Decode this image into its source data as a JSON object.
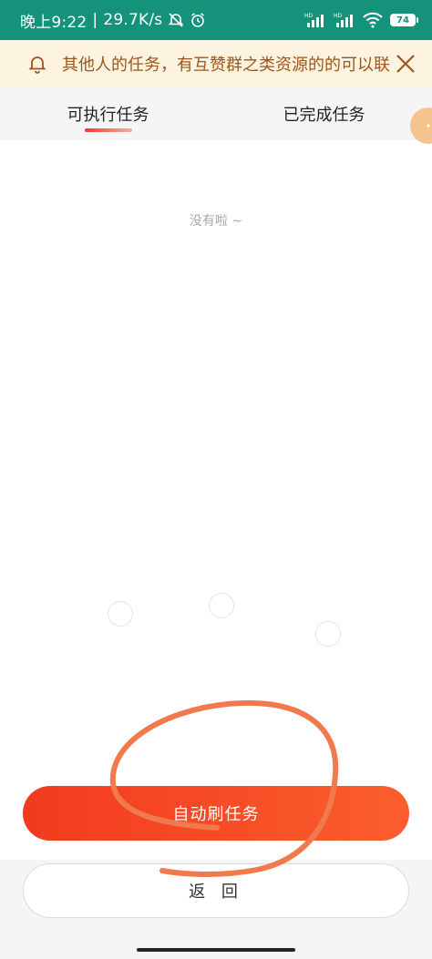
{
  "status_bar": {
    "time": "晚上9:22",
    "separator": "|",
    "network_speed": "29.7K/s",
    "battery_level": "74",
    "signal_1_label": "HD",
    "signal_2_label": "HD",
    "icons": [
      "mute-icon",
      "alarm-icon",
      "signal-icon",
      "signal-icon",
      "wifi-icon",
      "battery-icon"
    ],
    "background_color": "#15937a"
  },
  "notice": {
    "text": "其他人的任务，有互赞群之类资源的的可以联",
    "text_color": "#a0541c",
    "background_color": "#fcf4de"
  },
  "tabs": [
    {
      "label": "可执行任务",
      "active": true
    },
    {
      "label": "已完成任务",
      "active": false
    }
  ],
  "empty_state": {
    "text": "没有啦 ~"
  },
  "buttons": {
    "auto_refresh_label": "自动刷任务",
    "back_label": "返 回"
  },
  "colors": {
    "accent": "#f23a1e",
    "annotation_stroke": "#f07a4e"
  }
}
